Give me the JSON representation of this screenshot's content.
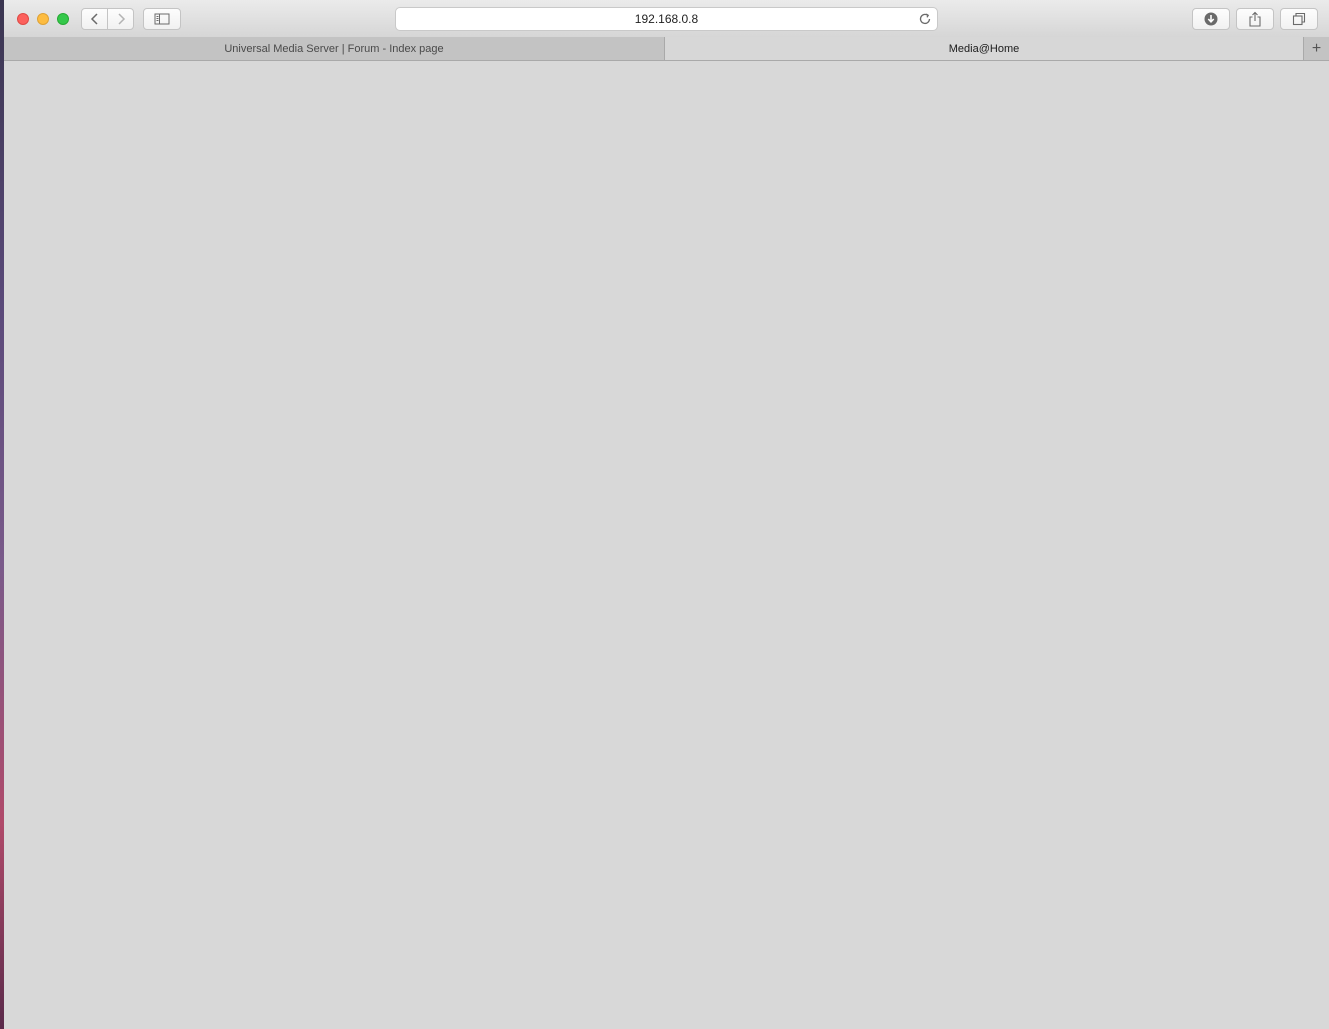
{
  "browser": {
    "url": "192.168.0.8",
    "tabs": [
      {
        "label": "Universal Media Server | Forum - Index page",
        "active": false
      },
      {
        "label": "Media@Home",
        "active": true
      }
    ],
    "new_tab_label": "+",
    "icons": {
      "back": "chevron-left-icon",
      "forward": "chevron-right-icon",
      "sidebar": "sidebar-icon",
      "reload": "reload-icon",
      "download": "download-icon",
      "share": "share-icon",
      "tabs": "tab-overview-icon"
    },
    "colors": {
      "close": "#fc605c",
      "minimize": "#fdbc40",
      "maximize": "#34c84a",
      "page_background": "#d8d8d8"
    }
  }
}
